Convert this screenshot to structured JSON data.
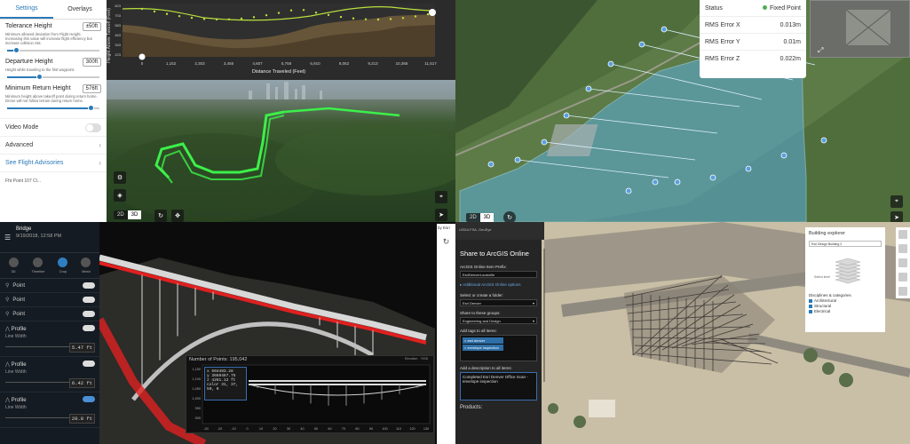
{
  "flight": {
    "tabs": [
      "Settings",
      "Overlays"
    ],
    "active_tab": "Settings",
    "tolerance": {
      "label": "Tolerance Height",
      "value": "±50ft",
      "hint": "Minimum allowed deviation from Flight Height. Increasing this value will increase flight efficiency but increase collision risk.",
      "level": 0.1
    },
    "departure": {
      "label": "Departure Height",
      "value": "300ft",
      "hint": "Height while traveling to the first waypoint.",
      "level": 0.35
    },
    "min_return": {
      "label": "Minimum Return Height",
      "value": "576ft",
      "hint": "Minimum height above takeoff point during return home. Drone will not follow terrain during return home.",
      "level": 0.9
    },
    "video_mode": "Video Mode",
    "advanced": "Advanced",
    "advisories": "See Flight Advisories",
    "footer": "Fht Point 107 Cl...",
    "profile": {
      "ylabel": "Height Above Takeoff (Feet)",
      "xlabel": "Distance Traveled (Feet)",
      "yticks": [
        "823",
        "703",
        "583",
        "463",
        "343",
        "223"
      ],
      "xticks": [
        "0",
        "1,152",
        "2,303",
        "3,455",
        "4,607",
        "5,758",
        "6,910",
        "8,062",
        "9,213",
        "10,365",
        "11,517"
      ]
    },
    "view": {
      "mode_2d": "2D",
      "mode_3d": "3D"
    }
  },
  "mapping": {
    "status_rows": [
      {
        "label": "Status",
        "value": "Fixed Point",
        "ok": true
      },
      {
        "label": "RMS Error X",
        "value": "0.013m"
      },
      {
        "label": "RMS Error Y",
        "value": "0.01m"
      },
      {
        "label": "RMS Error Z",
        "value": "0.022m"
      }
    ],
    "view": {
      "mode_2d": "2D",
      "mode_3d": "3D"
    }
  },
  "bridge": {
    "title": "Bridge",
    "date": "9/19/2018, 12:58 PM",
    "modes": [
      "3D",
      "Timeline",
      "Crop",
      "Mesh"
    ],
    "layers": [
      {
        "name": "Point",
        "on": false
      },
      {
        "name": "Point",
        "on": false
      },
      {
        "name": "Point",
        "on": false
      }
    ],
    "profiles": [
      {
        "name": "Profile",
        "width_label": "Line Width",
        "value": "5.47 ft",
        "on": false
      },
      {
        "name": "Profile",
        "width_label": "Line Width",
        "value": "6.42 ft",
        "on": false
      },
      {
        "name": "Profile",
        "width_label": "Line Width",
        "value": "20.0 ft",
        "on": true
      }
    ],
    "points_count": "Number of Points: 195,042",
    "readout": [
      "x   504493.28",
      "y   3669467.75",
      "z   4261.12 ft",
      "color 31, 37, 50, 0"
    ],
    "yticks": [
      "1,150",
      "1,100",
      "1,050",
      "1,000",
      "950",
      "900"
    ],
    "xticks": [
      "-30",
      "-20",
      "-10",
      "0",
      "10",
      "20",
      "30",
      "40",
      "50",
      "60",
      "70",
      "80",
      "90",
      "100",
      "110",
      "120",
      "130"
    ],
    "legend_labels": [
      "Elevation",
      "RGB"
    ],
    "corner": "by Esri"
  },
  "share": {
    "top_strip": "USDA FSA, GeoEye",
    "title": "Share to ArcGIS Online",
    "prefix_label": "ArcGIS Online Item Prefix:",
    "prefix_value": "EsriDenverLouisville",
    "options_link": "Additional ArcGIS Online options",
    "folder_label": "Select or create a folder:",
    "folder_value": "Esri Denver",
    "groups_label": "Share to these groups:",
    "groups_value": "Engineering and Design",
    "tags_label": "Add tags to all items:",
    "tags": [
      "esri denver",
      "envelope inspection"
    ],
    "desc_label": "Add a description to all items:",
    "desc_value": "Completed Esri Denver Office Scan - envelope inspection",
    "products_label": "Products:"
  },
  "building": {
    "title": "Building explorer",
    "dropdown": "Esri Design Building 2",
    "layer_label": "Select level",
    "section": "Disciplines & categories",
    "categories": [
      "Architectural",
      "Structural",
      "Electrical"
    ]
  },
  "colors": {
    "accent": "#2a7ab8",
    "flight_path": "#3cf04a",
    "bridge_red": "#e02020",
    "coverage": "#5aa8d0"
  }
}
